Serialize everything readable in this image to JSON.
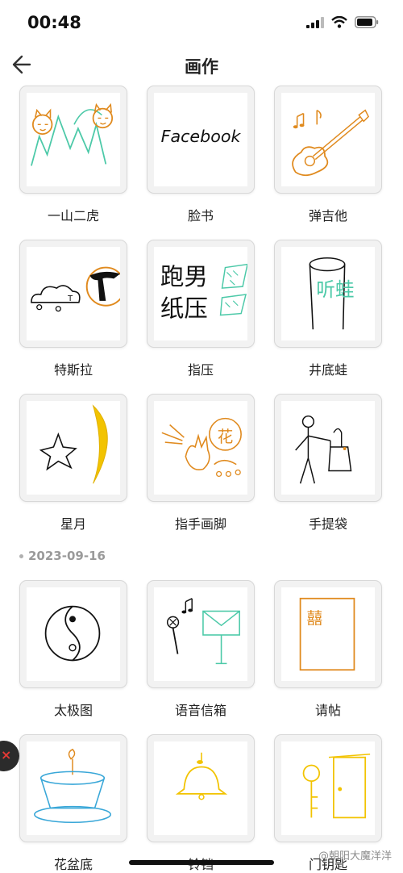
{
  "status": {
    "time": "00:48"
  },
  "header": {
    "title": "画作"
  },
  "sections": [
    {
      "date": "",
      "items": [
        {
          "label": "一山二虎"
        },
        {
          "label": "脸书"
        },
        {
          "label": "弹吉他"
        },
        {
          "label": "特斯拉"
        },
        {
          "label": "指压"
        },
        {
          "label": "井底蛙"
        },
        {
          "label": "星月"
        },
        {
          "label": "指手画脚"
        },
        {
          "label": "手提袋"
        }
      ]
    },
    {
      "date": "2023-09-16",
      "items": [
        {
          "label": "太极图"
        },
        {
          "label": "语音信箱"
        },
        {
          "label": "请帖"
        },
        {
          "label": "花盆底"
        },
        {
          "label": "铃铛"
        },
        {
          "label": "门钥匙"
        }
      ]
    }
  ],
  "drawing_text": {
    "facebook": "Facebook",
    "pao_nan": "跑男",
    "zhi_ya": "纸压",
    "hua": "花",
    "ting_wa": "听蛙",
    "xi": "囍"
  },
  "floating": {
    "close_symbol": "×"
  },
  "watermark": "@朝阳大魔洋洋",
  "colors": {
    "orange": "#e08a1e",
    "teal": "#4cc9a8",
    "yellow": "#f2c300",
    "black": "#111111",
    "blue": "#39a7d8"
  }
}
